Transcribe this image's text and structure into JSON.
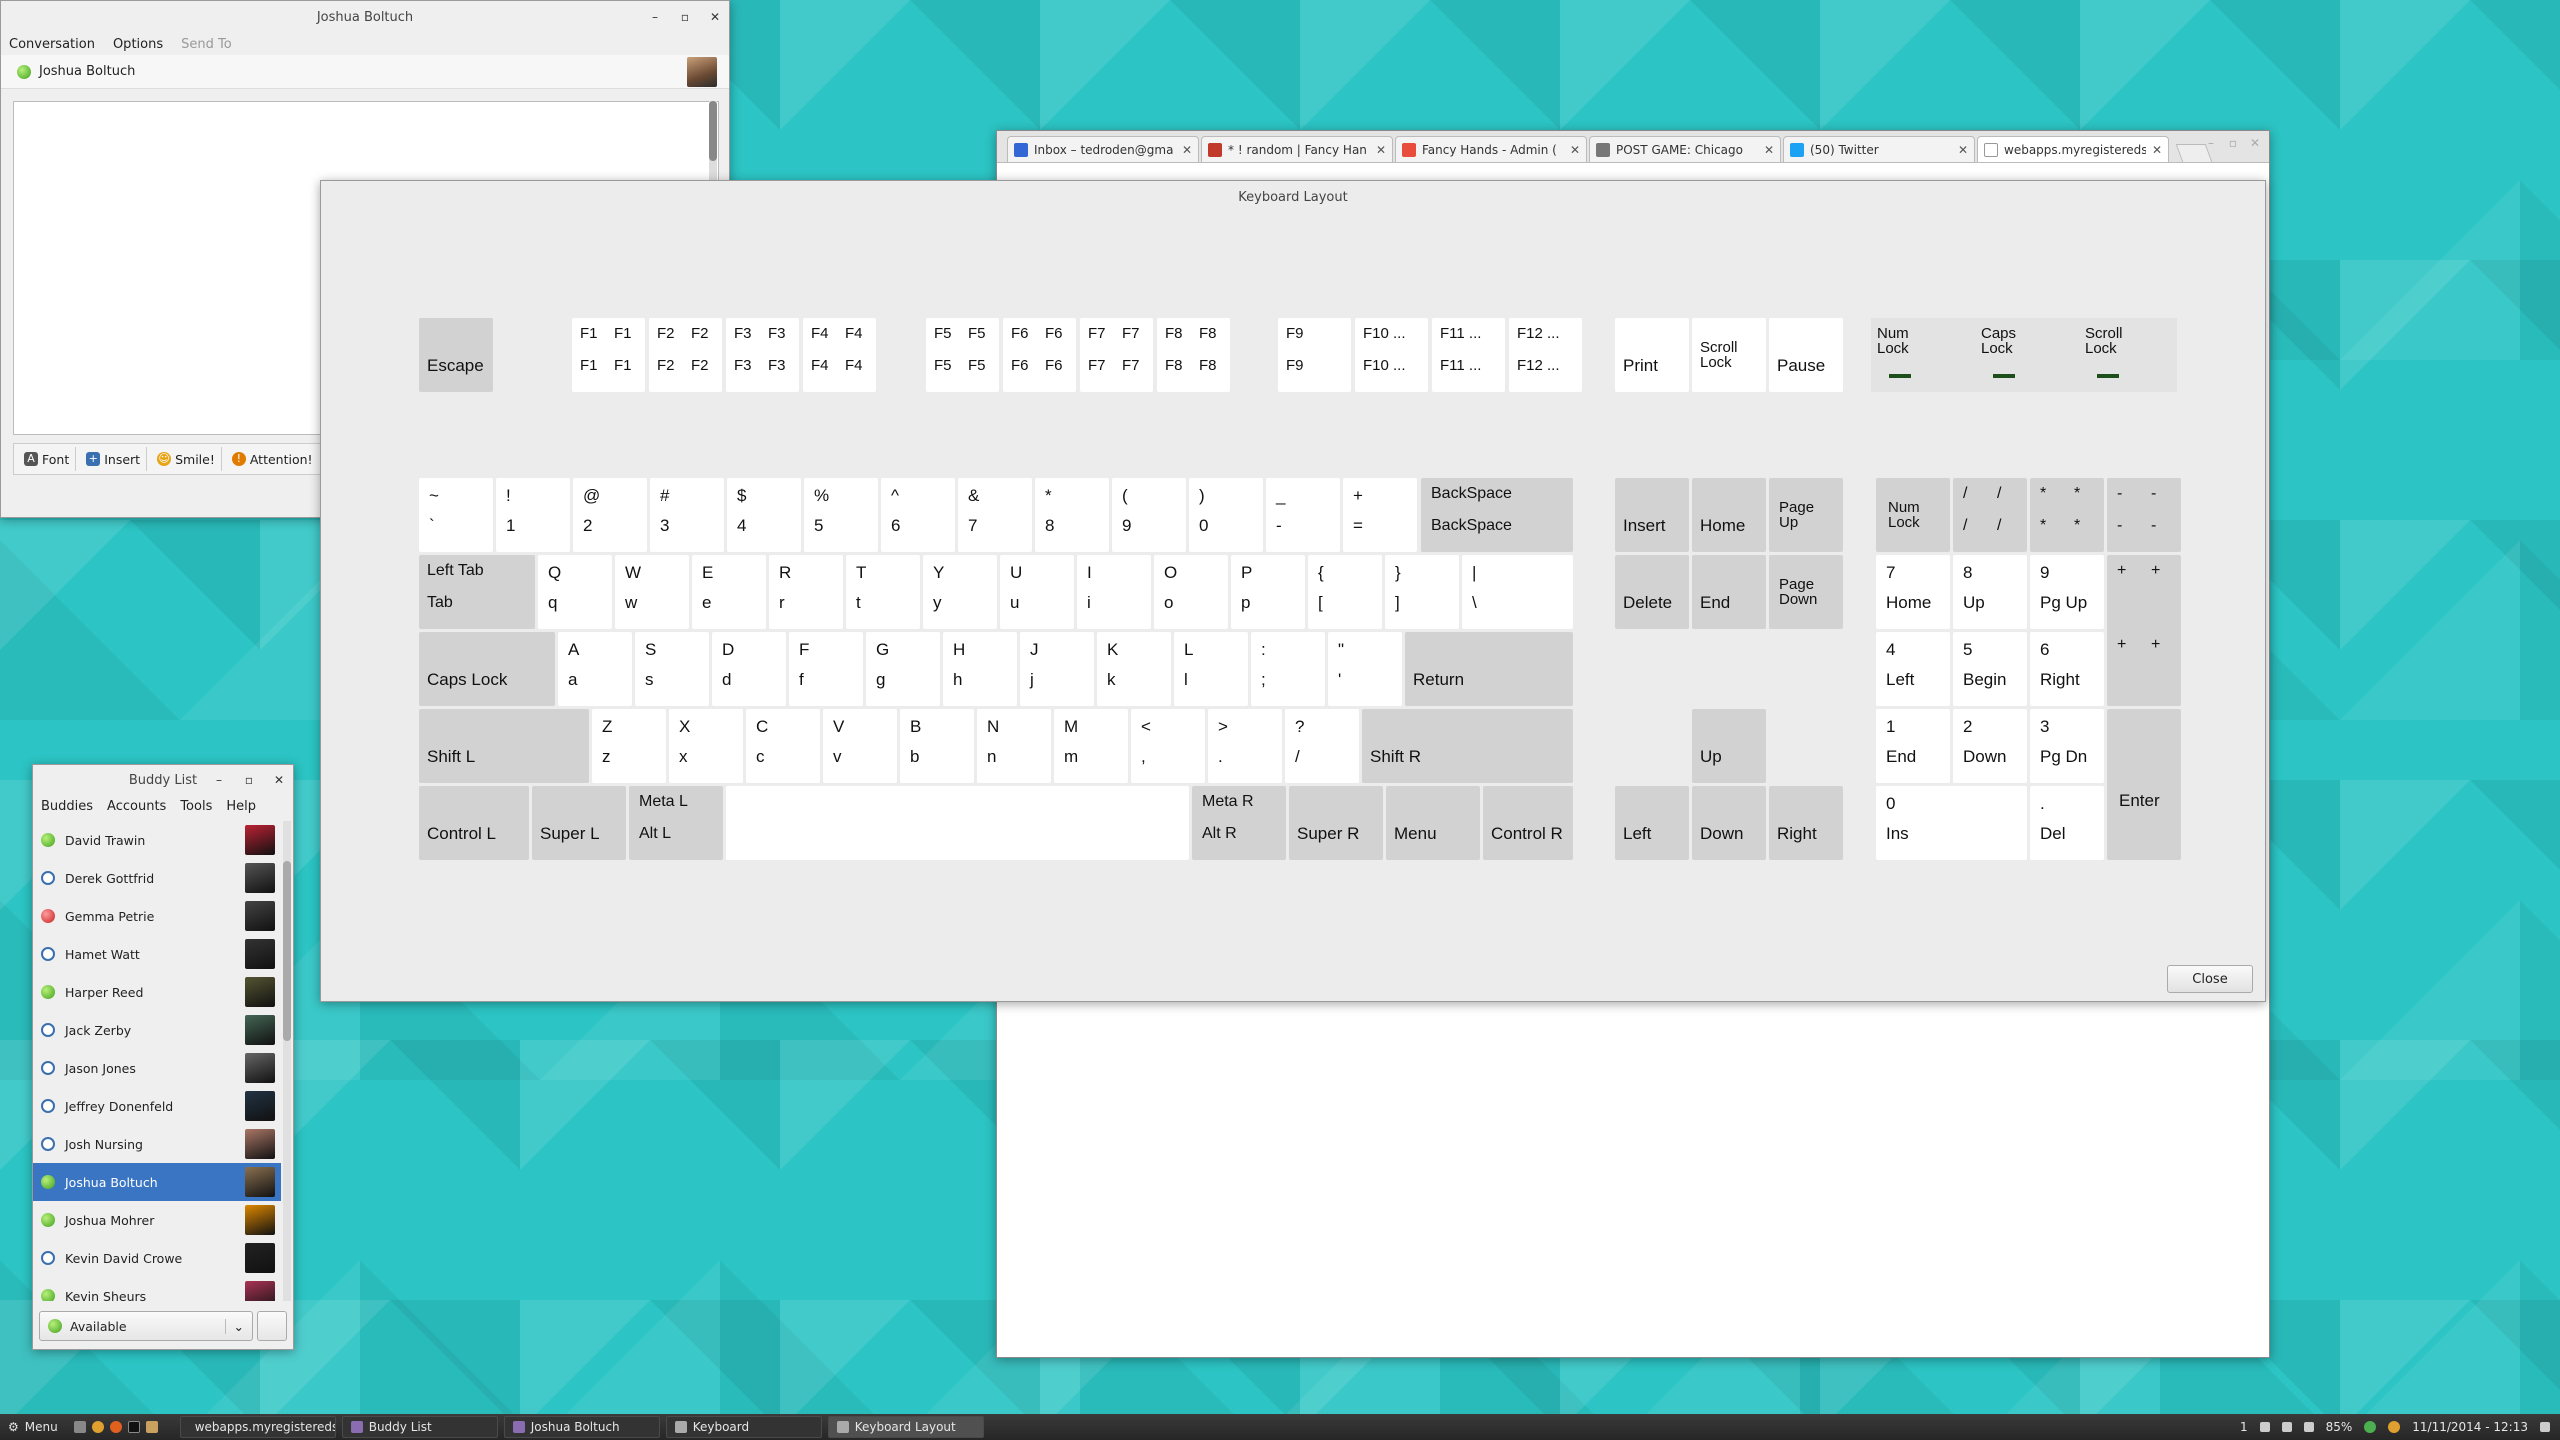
{
  "conversation_window": {
    "title": "Joshua Boltuch",
    "menu": [
      "Conversation",
      "Options",
      "Send To"
    ],
    "contact_name": "Joshua Boltuch",
    "toolbar": {
      "font": "Font",
      "insert": "Insert",
      "smile": "Smile!",
      "attention": "Attention!"
    }
  },
  "browser": {
    "tabs": [
      {
        "title": "Inbox – tedroden@gma",
        "color": "#3367d6"
      },
      {
        "title": "* ! random | Fancy Han",
        "color": "#c0392b"
      },
      {
        "title": "Fancy Hands - Admin (",
        "color": "#e74c3c"
      },
      {
        "title": "POST GAME: Chicago",
        "color": "#777777"
      },
      {
        "title": "(50) Twitter",
        "color": "#1da1f2"
      },
      {
        "title": "webapps.myregistereds",
        "color": "#999999"
      }
    ]
  },
  "keyboard_layout": {
    "title": "Keyboard Layout",
    "close_label": "Close",
    "keys": {
      "escape": "Escape",
      "f1": [
        "F1",
        "F1",
        "F1",
        "F1"
      ],
      "f2": [
        "F2",
        "F2",
        "F2",
        "F2"
      ],
      "f3": [
        "F3",
        "F3",
        "F3",
        "F3"
      ],
      "f4": [
        "F4",
        "F4",
        "F4",
        "F4"
      ],
      "f5": [
        "F5",
        "F5",
        "F5",
        "F5"
      ],
      "f6": [
        "F6",
        "F6",
        "F6",
        "F6"
      ],
      "f7": [
        "F7",
        "F7",
        "F7",
        "F7"
      ],
      "f8": [
        "F8",
        "F8",
        "F8",
        "F8"
      ],
      "f9": [
        "F9",
        "F9",
        "F9",
        "F9"
      ],
      "f10": [
        "F10 ...",
        "F10 ..."
      ],
      "f11": [
        "F11 ...",
        "F11 ..."
      ],
      "f12": [
        "F12 ...",
        "F12 ..."
      ],
      "print": "Print",
      "scroll_lock": "Scroll\nLock",
      "pause": "Pause",
      "num_lock_ind": "Num\nLock",
      "caps_lock_ind": "Caps\nLock",
      "scroll_lock_ind": "Scroll\nLock",
      "tilde": [
        "~",
        "`"
      ],
      "k1": [
        "!",
        "1"
      ],
      "k2": [
        "@",
        "2"
      ],
      "k3": [
        "#",
        "3"
      ],
      "k4": [
        "$",
        "4"
      ],
      "k5": [
        "%",
        "5"
      ],
      "k6": [
        "^",
        "6"
      ],
      "k7": [
        "&",
        "7"
      ],
      "k8": [
        "*",
        "8"
      ],
      "k9": [
        "(",
        "9"
      ],
      "k0": [
        ")",
        "0"
      ],
      "minus": [
        "_",
        "-"
      ],
      "equal": [
        "+",
        "="
      ],
      "backspace": [
        "BackSpace",
        "BackSpace"
      ],
      "tab": [
        "Left Tab",
        "Tab"
      ],
      "q": [
        "Q",
        "q"
      ],
      "w": [
        "W",
        "w"
      ],
      "e": [
        "E",
        "e"
      ],
      "r": [
        "R",
        "r"
      ],
      "t": [
        "T",
        "t"
      ],
      "y": [
        "Y",
        "y"
      ],
      "u": [
        "U",
        "u"
      ],
      "i": [
        "I",
        "i"
      ],
      "o": [
        "O",
        "o"
      ],
      "p": [
        "P",
        "p"
      ],
      "lbracket": [
        "{",
        "["
      ],
      "rbracket": [
        "}",
        "]"
      ],
      "backslash": [
        "|",
        "\\"
      ],
      "caps": "Caps Lock",
      "a": [
        "A",
        "a"
      ],
      "s": [
        "S",
        "s"
      ],
      "d": [
        "D",
        "d"
      ],
      "f": [
        "F",
        "f"
      ],
      "g": [
        "G",
        "g"
      ],
      "h": [
        "H",
        "h"
      ],
      "j": [
        "J",
        "j"
      ],
      "k": [
        "K",
        "k"
      ],
      "l": [
        "L",
        "l"
      ],
      "semicolon": [
        ":",
        ";"
      ],
      "quote": [
        "\"",
        "'"
      ],
      "return": "Return",
      "shift_l": "Shift L",
      "z": [
        "Z",
        "z"
      ],
      "x": [
        "X",
        "x"
      ],
      "c": [
        "C",
        "c"
      ],
      "v": [
        "V",
        "v"
      ],
      "b": [
        "B",
        "b"
      ],
      "n": [
        "N",
        "n"
      ],
      "m": [
        "M",
        "m"
      ],
      "comma": [
        "<",
        ","
      ],
      "period": [
        ">",
        "."
      ],
      "slash": [
        "?",
        "/"
      ],
      "shift_r": "Shift R",
      "control_l": "Control L",
      "super_l": "Super L",
      "meta_l": [
        "Meta L",
        "Alt L"
      ],
      "meta_r": [
        "Meta R",
        "Alt R"
      ],
      "super_r": "Super R",
      "menu": "Menu",
      "control_r": "Control R",
      "insert": "Insert",
      "home": "Home",
      "page_up": "Page\nUp",
      "delete": "Delete",
      "end": "End",
      "page_down": "Page\nDown",
      "up": "Up",
      "left": "Left",
      "down": "Down",
      "right": "Right",
      "kp_numlock": "Num\nLock",
      "kp_div": [
        "/",
        "/",
        "/",
        "/"
      ],
      "kp_mul": [
        "*",
        "*",
        "*",
        "*"
      ],
      "kp_minus": [
        "-",
        "-",
        "-",
        "-"
      ],
      "kp7": [
        "7",
        "Home"
      ],
      "kp8": [
        "8",
        "Up"
      ],
      "kp9": [
        "9",
        "Pg Up"
      ],
      "kp_plus": [
        "+",
        "+",
        "+",
        "+"
      ],
      "kp4": [
        "4",
        "Left"
      ],
      "kp5": [
        "5",
        "Begin"
      ],
      "kp6": [
        "6",
        "Right"
      ],
      "kp1": [
        "1",
        "End"
      ],
      "kp2": [
        "2",
        "Down"
      ],
      "kp3": [
        "3",
        "Pg Dn"
      ],
      "kp_enter": "Enter",
      "kp0": [
        "0",
        "Ins"
      ],
      "kp_dot": [
        ".",
        "Del"
      ]
    }
  },
  "buddy_list": {
    "title": "Buddy List",
    "menu": [
      "Buddies",
      "Accounts",
      "Tools",
      "Help"
    ],
    "buddies": [
      {
        "name": "David Trawin",
        "status": "available"
      },
      {
        "name": "Derek Gottfrid",
        "status": "away"
      },
      {
        "name": "Gemma Petrie",
        "status": "busy"
      },
      {
        "name": "Hamet Watt",
        "status": "away"
      },
      {
        "name": "Harper Reed",
        "status": "available"
      },
      {
        "name": "Jack Zerby",
        "status": "away"
      },
      {
        "name": "Jason Jones",
        "status": "away"
      },
      {
        "name": "Jeffrey Donenfeld",
        "status": "away"
      },
      {
        "name": "Josh Nursing",
        "status": "away"
      },
      {
        "name": "Joshua Boltuch",
        "status": "available"
      },
      {
        "name": "Joshua Mohrer",
        "status": "available"
      },
      {
        "name": "Kevin David Crowe",
        "status": "away"
      },
      {
        "name": "Kevin Sheurs",
        "status": "available"
      }
    ],
    "status_value": "Available"
  },
  "taskbar": {
    "menu_label": "Menu",
    "tasks": [
      {
        "label": "webapps.myregistereds..."
      },
      {
        "label": "Buddy List"
      },
      {
        "label": "Joshua Boltuch"
      },
      {
        "label": "Keyboard"
      },
      {
        "label": "Keyboard Layout"
      }
    ],
    "workspace": "1",
    "battery": "85%",
    "clock": "11/11/2014 - 12:13"
  }
}
